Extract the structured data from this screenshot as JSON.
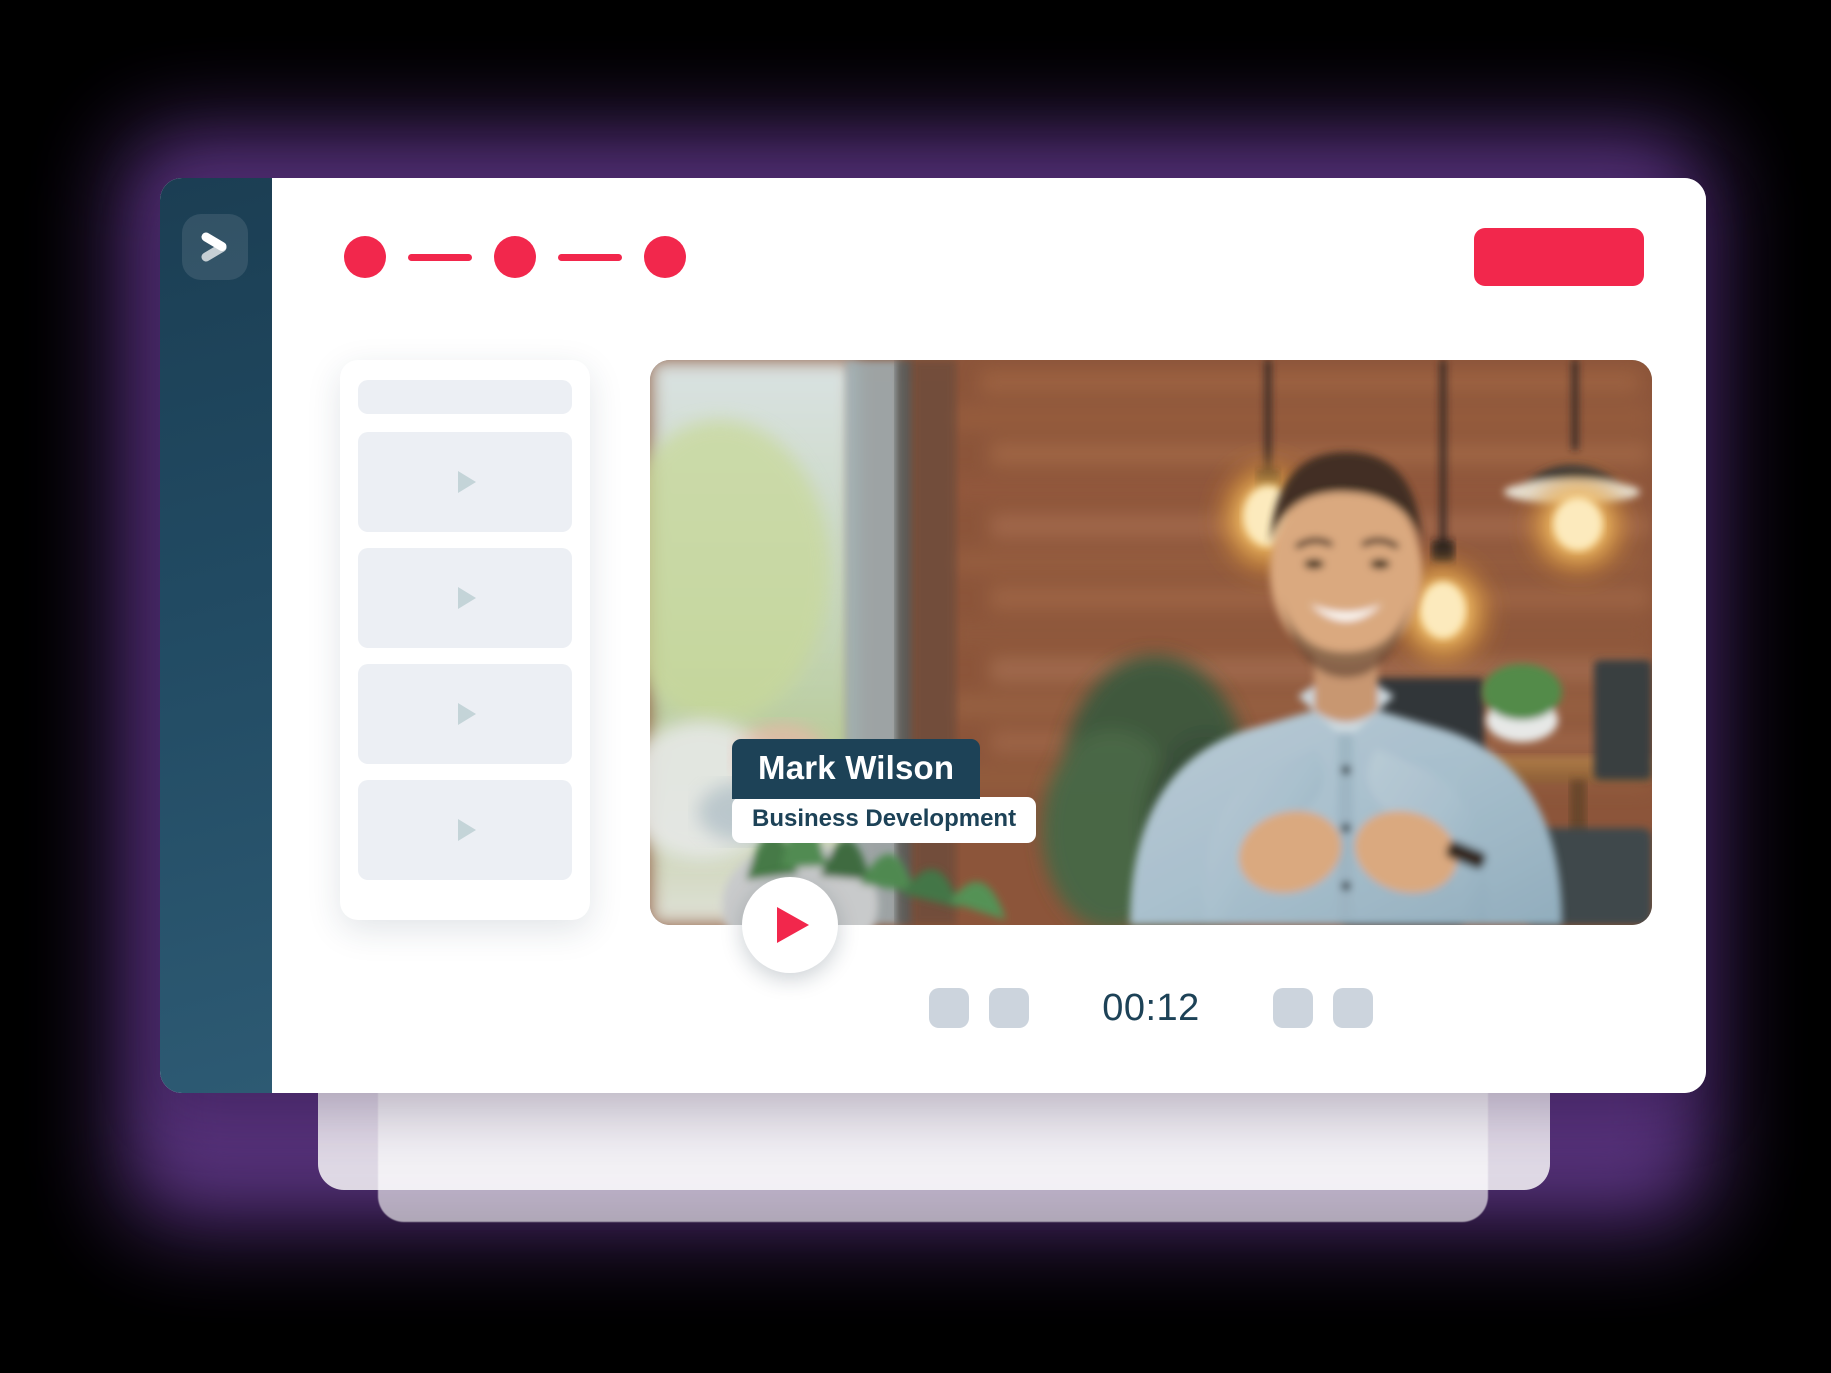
{
  "app": {
    "logo_icon": "chevron-play-logo",
    "brand_color": "#f2274c",
    "sidebar_color": "#1d4257"
  },
  "topbar": {
    "cta_label": "",
    "cta_color": "#f2274c",
    "steps": [
      {
        "type": "dot",
        "state": "active"
      },
      {
        "type": "line"
      },
      {
        "type": "dot",
        "state": "active"
      },
      {
        "type": "line"
      },
      {
        "type": "dot",
        "state": "active"
      }
    ]
  },
  "sidebar_list": {
    "header_label": "",
    "items": [
      {
        "icon": "play-triangle-icon",
        "label": ""
      },
      {
        "icon": "play-triangle-icon",
        "label": ""
      },
      {
        "icon": "play-triangle-icon",
        "label": ""
      },
      {
        "icon": "play-triangle-icon",
        "label": ""
      }
    ]
  },
  "player": {
    "nameplate": {
      "name": "Mark Wilson",
      "role": "Business Development"
    },
    "play_button_icon": "play-icon",
    "scene": "man in light blue shirt speaking, brick wall with pendant edison bulbs, plants, office desk and chairs, bright window"
  },
  "controls": {
    "timer": "00:12",
    "left_buttons": [
      {
        "icon": "control-button-icon"
      },
      {
        "icon": "control-button-icon"
      }
    ],
    "right_buttons": [
      {
        "icon": "control-button-icon"
      },
      {
        "icon": "control-button-icon"
      }
    ]
  }
}
